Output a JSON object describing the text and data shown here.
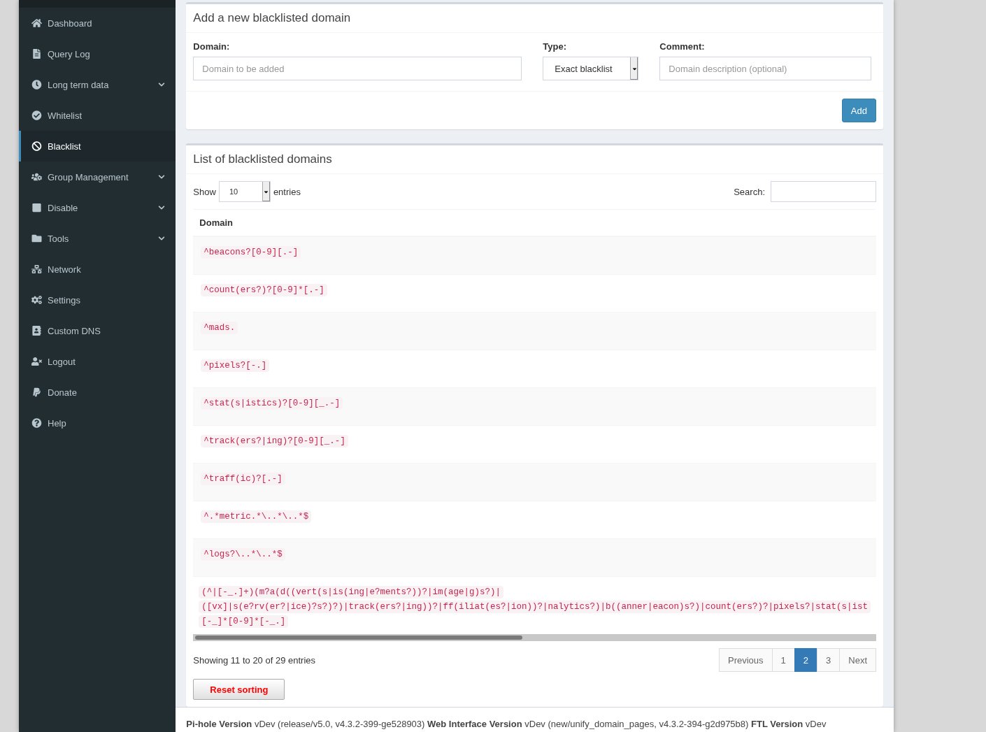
{
  "sidebar": {
    "items": [
      {
        "label": "Dashboard",
        "selected": false,
        "has_submenu": false
      },
      {
        "label": "Query Log",
        "selected": false,
        "has_submenu": false
      },
      {
        "label": "Long term data",
        "selected": false,
        "has_submenu": true
      },
      {
        "label": "Whitelist",
        "selected": false,
        "has_submenu": false
      },
      {
        "label": "Blacklist",
        "selected": true,
        "has_submenu": false
      },
      {
        "label": "Group Management",
        "selected": false,
        "has_submenu": true
      },
      {
        "label": "Disable",
        "selected": false,
        "has_submenu": true
      },
      {
        "label": "Tools",
        "selected": false,
        "has_submenu": true
      },
      {
        "label": "Network",
        "selected": false,
        "has_submenu": false
      },
      {
        "label": "Settings",
        "selected": false,
        "has_submenu": false
      },
      {
        "label": "Custom DNS",
        "selected": false,
        "has_submenu": false
      },
      {
        "label": "Logout",
        "selected": false,
        "has_submenu": false
      },
      {
        "label": "Donate",
        "selected": false,
        "has_submenu": false
      },
      {
        "label": "Help",
        "selected": false,
        "has_submenu": false
      }
    ]
  },
  "add_form": {
    "title": "Add a new blacklisted domain",
    "domain": {
      "label": "Domain:",
      "placeholder": "Domain to be added"
    },
    "type": {
      "label": "Type:",
      "value": "Exact blacklist"
    },
    "comment": {
      "label": "Comment:",
      "placeholder": "Domain description (optional)"
    },
    "button": "Add"
  },
  "list": {
    "title": "List of blacklisted domains",
    "show_label": "Show",
    "page_size": "10",
    "entries_label": "entries",
    "search_label": "Search:",
    "columns": [
      "Domain"
    ],
    "rows": [
      {
        "lines": [
          "^beacons?[0-9][.-]"
        ]
      },
      {
        "lines": [
          "^count(ers?)?[0-9]*[.-]"
        ]
      },
      {
        "lines": [
          "^mads."
        ]
      },
      {
        "lines": [
          "^pixels?[-.]"
        ]
      },
      {
        "lines": [
          "^stat(s|istics)?[0-9][_.-]"
        ]
      },
      {
        "lines": [
          "^track(ers?|ing)?[0-9][_.-]"
        ]
      },
      {
        "lines": [
          "^traff(ic)?[.-]"
        ]
      },
      {
        "lines": [
          "^.*metric.*\\..*\\..*$"
        ]
      },
      {
        "lines": [
          "^logs?\\..*\\..*$"
        ]
      },
      {
        "lines": [
          "(^|[-_.]+)(m?a(d((vert(s|is(ing|e?ments?))?|im(age|g)s?)|",
          "([vx]|s(e?rv(er?|ice)?s?)?)|track(ers?|ing))?|ff(iliat(es?|ion))?|nalytics?)|b((anner|eacon)s?)|count(ers?)?|pixels?|stat(s|ist",
          "[-_]*[0-9]*[-_.]"
        ]
      }
    ],
    "info": "Showing 11 to 20 of 29 entries",
    "pagination": [
      {
        "label": "Previous",
        "selected": false
      },
      {
        "label": "1",
        "selected": false
      },
      {
        "label": "2",
        "selected": true
      },
      {
        "label": "3",
        "selected": false
      },
      {
        "label": "Next",
        "selected": false
      }
    ],
    "reset_button": "Reset sorting"
  },
  "footer": "**Pi-hole Version** vDev (release/v5.0, v4.3.2-399-ge528903) **Web Interface Version** vDev (new/unify_domain_pages, v4.3.2-394-g2d975b8) **FTL Version** vDev"
}
